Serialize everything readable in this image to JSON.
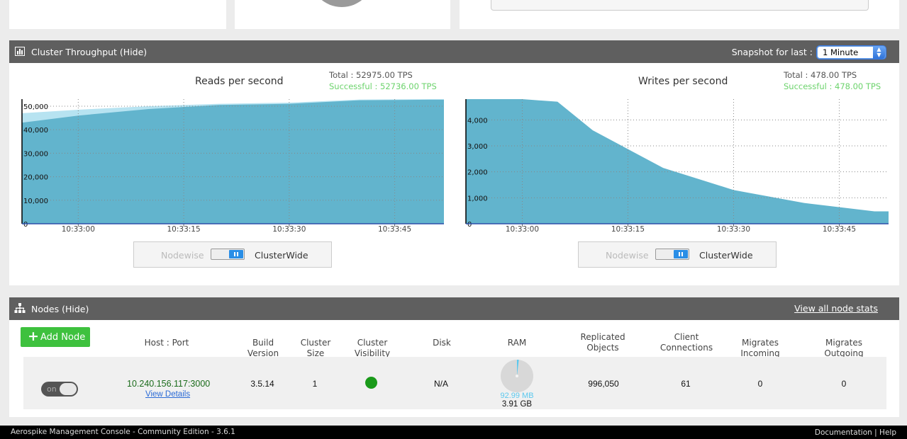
{
  "throughput": {
    "title": "Cluster Throughput (Hide)",
    "snapshot_label": "Snapshot for last :",
    "snapshot_value": "1 Minute",
    "reads": {
      "title": "Reads per second",
      "total": "Total : 52975.00 TPS",
      "successful": "Successful : 52736.00 TPS"
    },
    "writes": {
      "title": "Writes per second",
      "total": "Total : 478.00 TPS",
      "successful": "Successful : 478.00 TPS"
    },
    "toggle": {
      "nodewise": "Nodewise",
      "clusterwide": "ClusterWide"
    }
  },
  "chart_data": [
    {
      "type": "area",
      "title": "Reads per second",
      "x": [
        "10:32:50",
        "10:33:00",
        "10:33:10",
        "10:33:20",
        "10:33:30",
        "10:33:40",
        "10:33:50"
      ],
      "x_ticks": [
        "10:33:00",
        "10:33:15",
        "10:33:30",
        "10:33:45"
      ],
      "y_ticks": [
        "0",
        "10,000",
        "20,000",
        "30,000",
        "40,000",
        "50,000"
      ],
      "ylim": [
        0,
        53000
      ],
      "series": [
        {
          "values": [
            47000,
            48500,
            50000,
            51000,
            51500,
            52800,
            53000
          ]
        },
        {
          "values": [
            43000,
            46000,
            48800,
            50500,
            51000,
            52500,
            52736
          ]
        }
      ],
      "grid": true
    },
    {
      "type": "area",
      "title": "Writes per second",
      "x": [
        "10:32:50",
        "10:33:00",
        "10:33:05",
        "10:33:10",
        "10:33:20",
        "10:33:30",
        "10:33:40",
        "10:33:50"
      ],
      "x_ticks": [
        "10:33:00",
        "10:33:15",
        "10:33:30",
        "10:33:45"
      ],
      "y_ticks": [
        "0",
        "1,000",
        "2,000",
        "3,000",
        "4,000"
      ],
      "ylim": [
        0,
        4800
      ],
      "series": [
        {
          "values": [
            4800,
            4800,
            4700,
            3600,
            2150,
            1300,
            800,
            478
          ]
        }
      ],
      "grid": true
    }
  ],
  "nodes": {
    "title": "Nodes (Hide)",
    "view_all": "View all node stats",
    "add_node": "Add Node",
    "columns": [
      "Host : Port",
      "Build Version",
      "Cluster Size",
      "Cluster Visibility",
      "Disk",
      "RAM",
      "Replicated Objects",
      "Client Connections",
      "Migrates Incoming",
      "Migrates Outgoing"
    ],
    "rows": [
      {
        "toggle": "on",
        "host": "10.240.156.117:3000",
        "view_details": "View Details",
        "build": "3.5.14",
        "cluster_size": "1",
        "disk": "N/A",
        "ram_used": "92.99 MB",
        "ram_total": "3.91 GB",
        "replicated": "996,050",
        "connections": "61",
        "migrates_in": "0",
        "migrates_out": "0"
      }
    ]
  },
  "footer": {
    "left": "Aerospike Management Console - Community Edition - 3.6.1",
    "documentation": "Documentation",
    "separator": "|",
    "help": "Help"
  },
  "colors": {
    "area_main": "#62b4cd",
    "area_light": "#b7e3f1",
    "header": "#5f5f5f",
    "success": "#6cd36c",
    "add_button": "#3ec13e"
  }
}
